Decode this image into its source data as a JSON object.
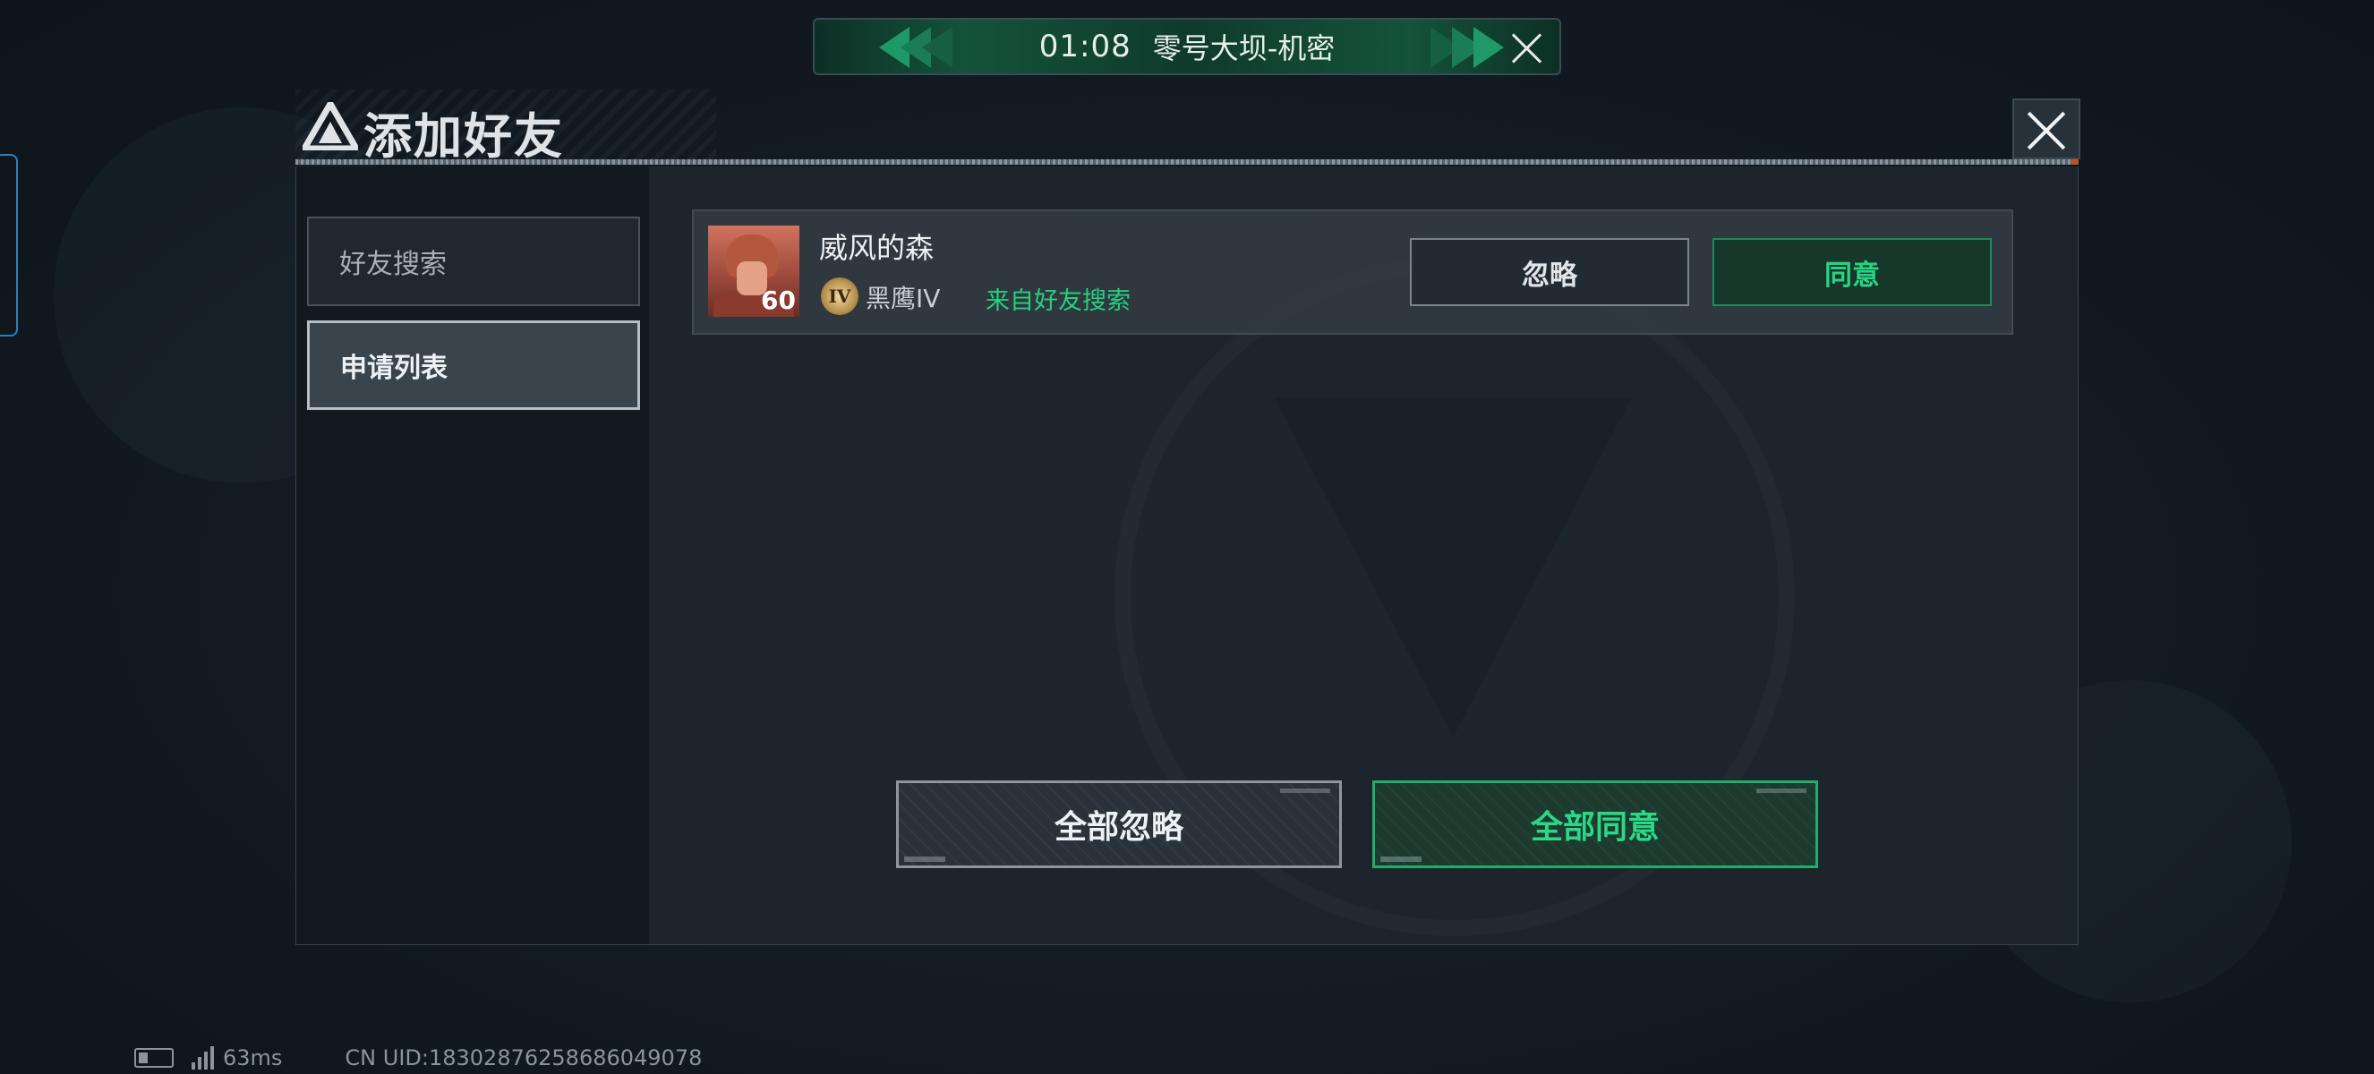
{
  "banner": {
    "time": "01:08",
    "map": "零号大坝-机密"
  },
  "dialog": {
    "title": "添加好友",
    "tabs": [
      {
        "label": "好友搜索",
        "active": false
      },
      {
        "label": "申请列表",
        "active": true
      }
    ]
  },
  "request": {
    "player_name": "威风的森",
    "level": "60",
    "rank_badge": "IV",
    "rank_name": "黑鹰IV",
    "source": "来自好友搜索",
    "ignore_label": "忽略",
    "agree_label": "同意"
  },
  "actions": {
    "ignore_all": "全部忽略",
    "agree_all": "全部同意"
  },
  "status": {
    "ping": "63ms",
    "uid": "CN UID:18302876258686049078"
  },
  "colors": {
    "accent_green": "#27d482",
    "banner_green": "#145339",
    "background": "#121a22"
  }
}
